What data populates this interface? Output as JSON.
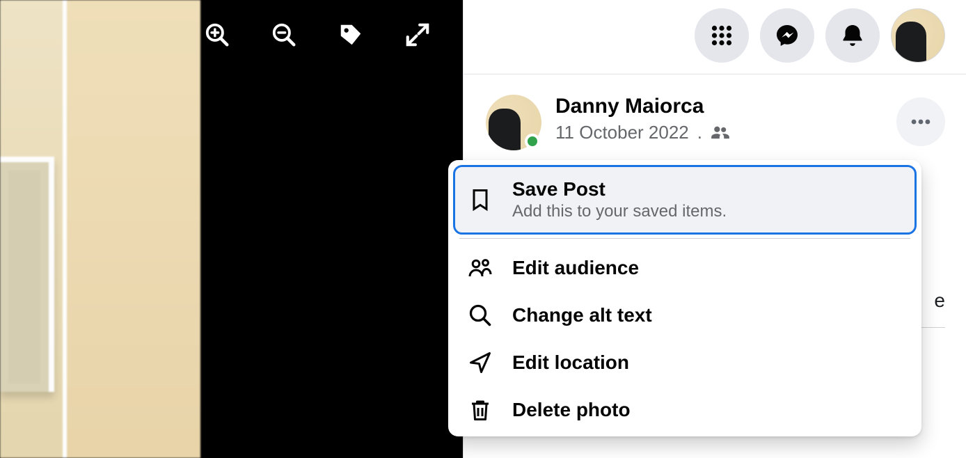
{
  "viewer": {
    "toolbar": {
      "zoom_in": "zoom-in",
      "zoom_out": "zoom-out",
      "tag": "tag",
      "fullscreen": "fullscreen"
    }
  },
  "header": {
    "icons": [
      "menu-grid",
      "messenger",
      "notifications",
      "profile-avatar"
    ]
  },
  "post": {
    "author": "Danny Maiorca",
    "date": "11 October 2022",
    "separator": ".",
    "audience_icon": "friends",
    "online": true
  },
  "menu": {
    "items": [
      {
        "id": "save",
        "title": "Save Post",
        "subtitle": "Add this to your saved items.",
        "icon": "bookmark",
        "focused": true
      },
      {
        "id": "audience",
        "title": "Edit audience",
        "icon": "people"
      },
      {
        "id": "alttext",
        "title": "Change alt text",
        "icon": "search"
      },
      {
        "id": "location",
        "title": "Edit location",
        "icon": "navigate"
      },
      {
        "id": "delete",
        "title": "Delete photo",
        "icon": "trash"
      }
    ]
  },
  "side_fragment": "e"
}
